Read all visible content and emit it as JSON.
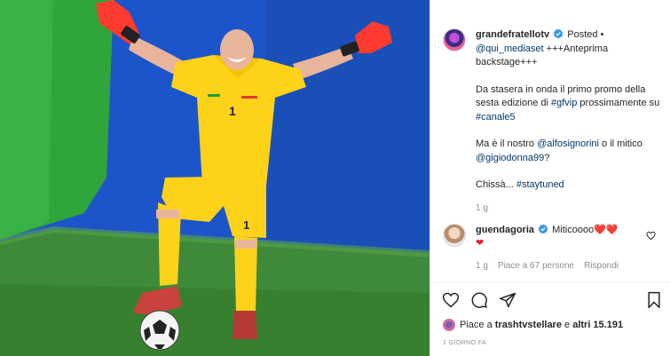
{
  "post": {
    "username": "grandefratellotv",
    "posted_label": "Posted •",
    "caption_line1_link": "@qui_mediaset",
    "caption_line1_rest": " +++Anteprima backstage+++",
    "para2_text": "Da stasera in onda il primo promo della sesta edizione di ",
    "para2_link1": "#gfvip",
    "para2_mid": " prossimamente su ",
    "para2_link2": "#canale5",
    "para3_text1": "Ma è il nostro ",
    "para3_link1": "@alfosignorini",
    "para3_text2": " o il mitico ",
    "para3_link2": "@gigiodonna99",
    "para3_text3": "?",
    "para4_text": "Chissà... ",
    "para4_link": "#staytuned",
    "age_short": "1 g"
  },
  "comment": {
    "username": "guendagoria",
    "text": "Miticoooo",
    "hearts": "❤️❤️",
    "heart_line2": "❤",
    "age": "1 g",
    "likes_label": "Piace a 67 persone",
    "reply_label": "Rispondi"
  },
  "footer": {
    "likes_prefix": "Piace a ",
    "likes_user": "trashtvstellare",
    "likes_mid": " e ",
    "likes_others": "altri 15.191",
    "time_ago": "1 GIORNO FA"
  },
  "icons": {
    "like": "heart-icon",
    "comment": "comment-icon",
    "share": "share-icon",
    "save": "bookmark-icon",
    "verified": "verified-badge-icon"
  },
  "colors": {
    "verified": "#3897f0",
    "link": "#00376b",
    "muted": "#8e8e8e",
    "heart": "#ed1c24"
  }
}
